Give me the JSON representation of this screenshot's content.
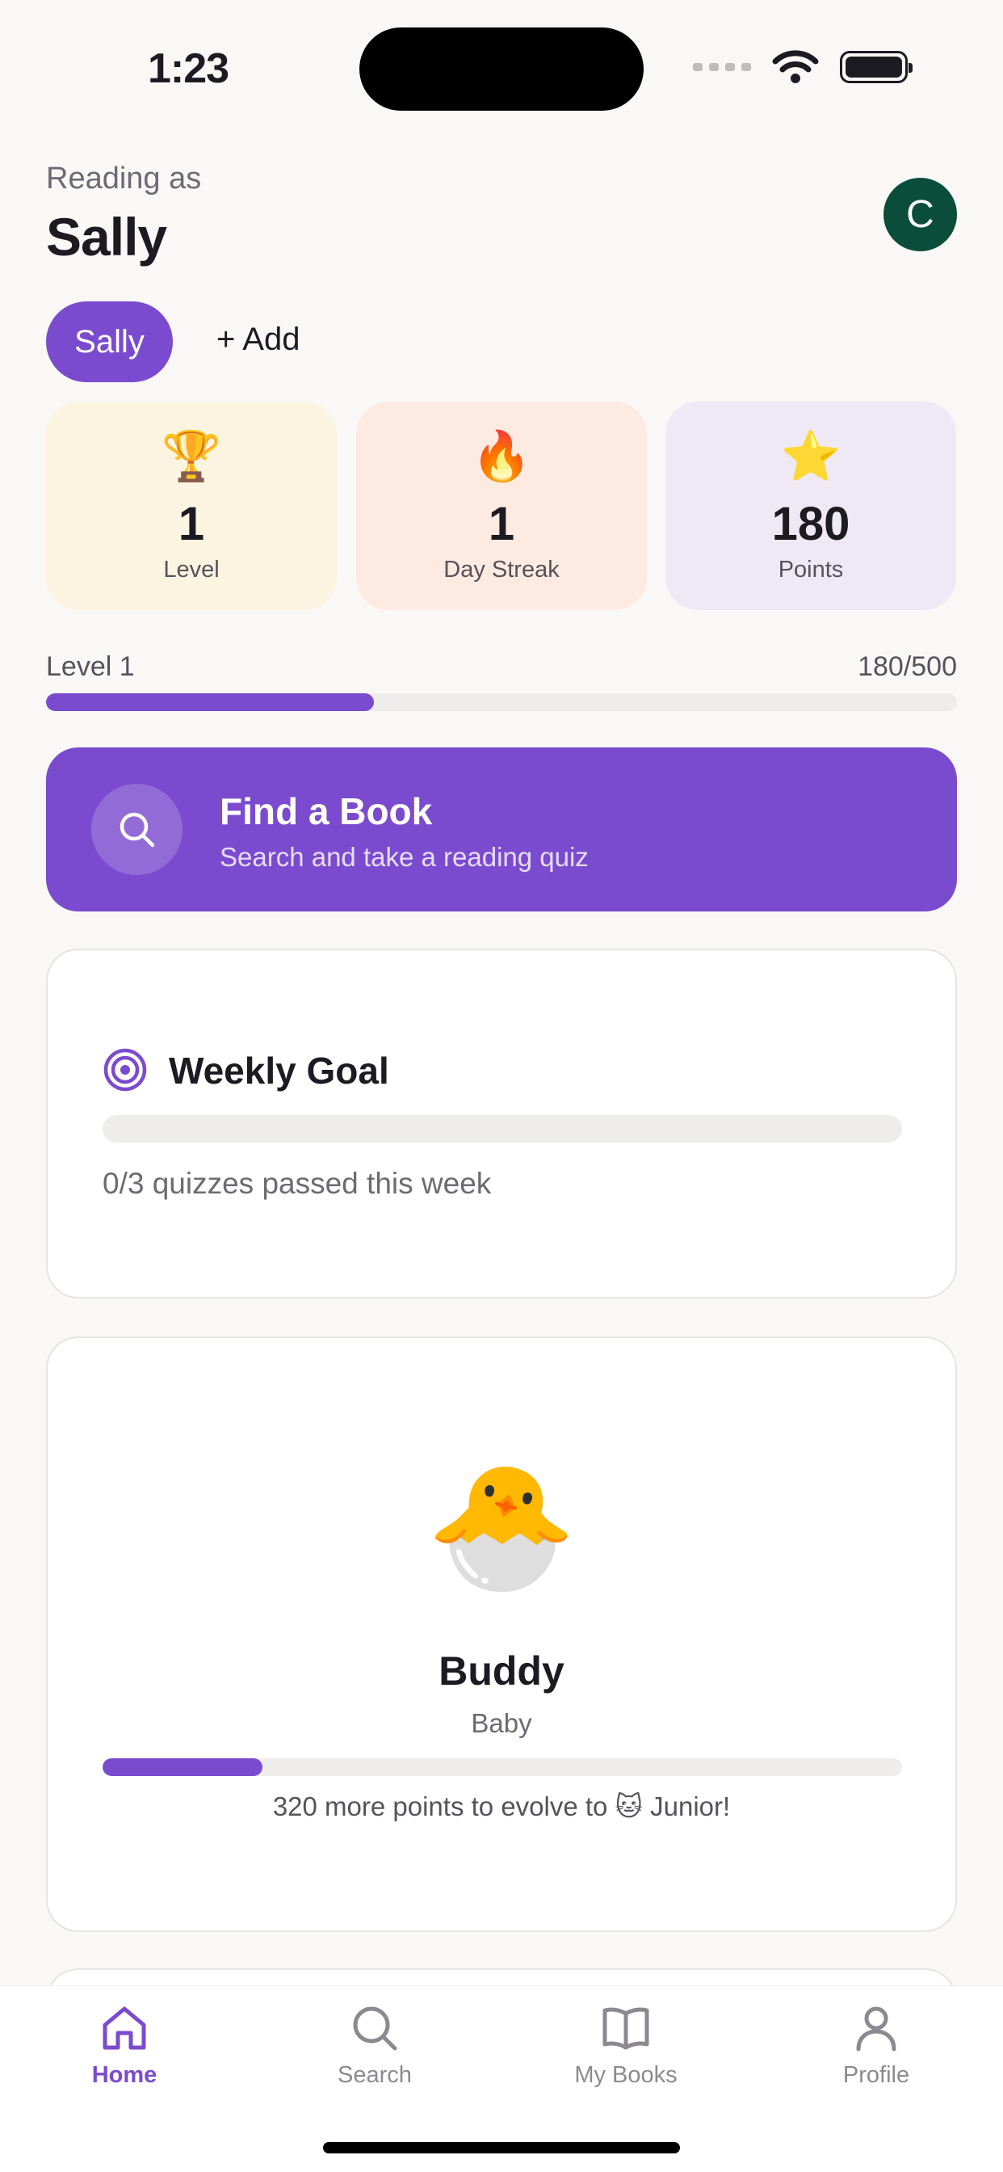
{
  "status_bar": {
    "time": "1:23"
  },
  "header": {
    "reading_as": "Reading as",
    "reader_name": "Sally",
    "avatar_initial": "C"
  },
  "readers": {
    "active": "Sally",
    "add_label": "+ Add"
  },
  "stats": [
    {
      "emoji": "🏆",
      "value": "1",
      "label": "Level"
    },
    {
      "emoji": "🔥",
      "value": "1",
      "label": "Day Streak"
    },
    {
      "emoji": "⭐",
      "value": "180",
      "label": "Points"
    }
  ],
  "level_progress": {
    "label": "Level 1",
    "count": "180/500",
    "fraction": 0.36
  },
  "find_book": {
    "title": "Find a Book",
    "subtitle": "Search and take a reading quiz",
    "icon": "search-icon"
  },
  "weekly_goal": {
    "title": "Weekly Goal",
    "icon": "target-icon",
    "status": "0/3 quizzes passed this week",
    "fraction": 0
  },
  "buddy": {
    "emoji": "🐣",
    "name": "Buddy",
    "stage": "Baby",
    "fraction": 0.2,
    "message": "320 more points to evolve to 🐱 Junior!"
  },
  "tabs": [
    {
      "label": "Home",
      "icon": "home-icon",
      "active": true
    },
    {
      "label": "Search",
      "icon": "search-icon",
      "active": false
    },
    {
      "label": "My Books",
      "icon": "book-icon",
      "active": false
    },
    {
      "label": "Profile",
      "icon": "person-icon",
      "active": false
    }
  ],
  "colors": {
    "accent": "#7b4bcf",
    "avatar": "#0b4d3b",
    "background": "#faf8f6"
  }
}
